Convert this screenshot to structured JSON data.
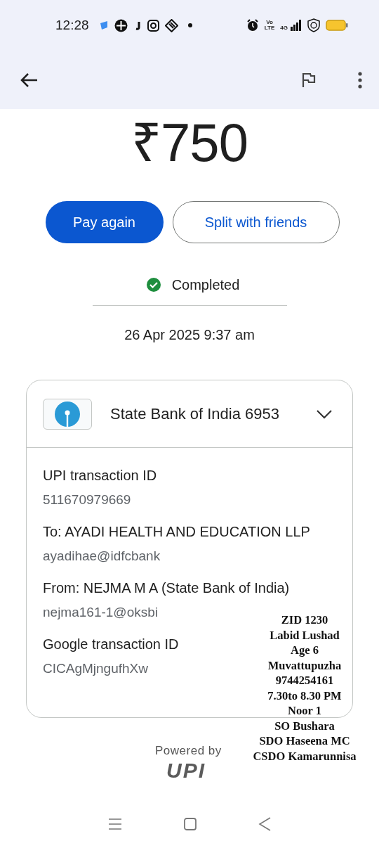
{
  "status_bar": {
    "time": "12:28",
    "volte": [
      "Vo",
      "LTE"
    ],
    "network": "4G"
  },
  "amount": "₹750",
  "buttons": [
    {
      "label": "Pay again",
      "kind": "primary"
    },
    {
      "label": "Split with friends",
      "kind": "outline"
    }
  ],
  "status": {
    "label": "Completed",
    "completed": true
  },
  "date": "26 Apr 2025 9:37 am",
  "card": {
    "bank": "State Bank of India 6953",
    "expanded": false,
    "fields": [
      {
        "label": "UPI transaction ID",
        "value": "511670979669"
      },
      {
        "label": "To: AYADI HEALTH AND EDUCATION LLP",
        "value": "ayadihae@idfcbank"
      },
      {
        "label": "From: NEJMA  M A (State Bank of India)",
        "value": "nejma161-1@oksbi"
      },
      {
        "label": "Google transaction ID",
        "value": "CICAgMjngufhXw"
      }
    ]
  },
  "powered_by": "Powered by",
  "upi_logo": "UPI",
  "overlay_note": [
    "ZID 1230",
    "Labid Lushad",
    "Age 6",
    "Muvattupuzha",
    "9744254161",
    "7.30to 8.30 PM",
    "Noor 1",
    "SO Bushara",
    "SDO Haseena MC",
    "CSDO Kamarunnisa"
  ]
}
